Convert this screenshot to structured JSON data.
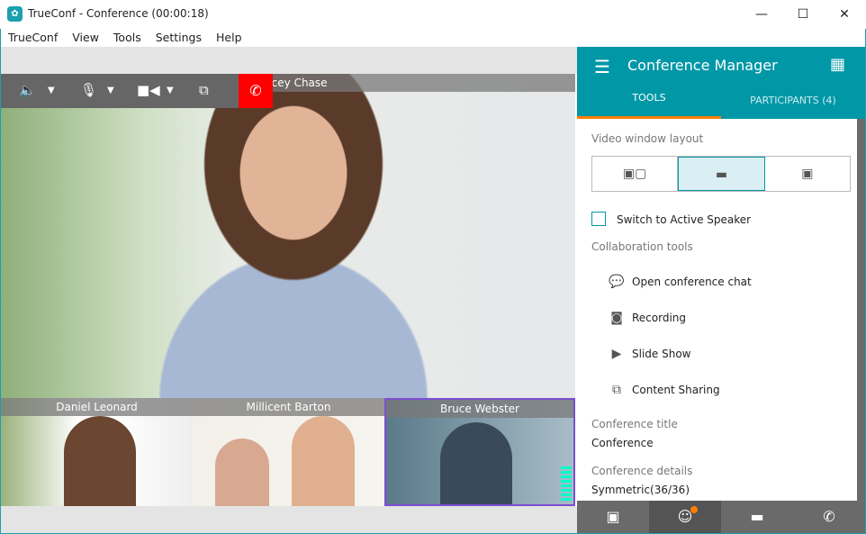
{
  "window": {
    "title": "TrueConf - Conference (00:00:18)",
    "minimize": "—",
    "maximize": "☐",
    "close": "✕"
  },
  "menu": [
    "TrueConf",
    "View",
    "Tools",
    "Settings",
    "Help"
  ],
  "video": {
    "main_speaker": "Stacey Chase",
    "main_speaker_visible": "cey Chase",
    "thumbnails": [
      {
        "name": "Daniel Leonard"
      },
      {
        "name": "Millicent Barton"
      },
      {
        "name": "Bruce Webster",
        "active": true
      }
    ]
  },
  "panel": {
    "title": "Conference Manager",
    "tabs": [
      {
        "label": "TOOLS",
        "selected": true
      },
      {
        "label": "PARTICIPANTS (4)"
      }
    ],
    "layout_label": "Video window layout",
    "layout_selected": 1,
    "active_speaker": {
      "label": "Switch to Active Speaker",
      "checked": false
    },
    "collab_label": "Collaboration tools",
    "tools": [
      "Open conference chat",
      "Recording",
      "Slide Show",
      "Content Sharing"
    ],
    "conf_title_label": "Conference title",
    "conf_title": "Conference",
    "conf_details_label": "Conference details",
    "conf_details": "Symmetric(36/36)"
  },
  "colors": {
    "accent": "#0097a7",
    "tab_underline": "#ff7f00",
    "hangup": "#ff0000",
    "badge": "#ff7f00"
  }
}
